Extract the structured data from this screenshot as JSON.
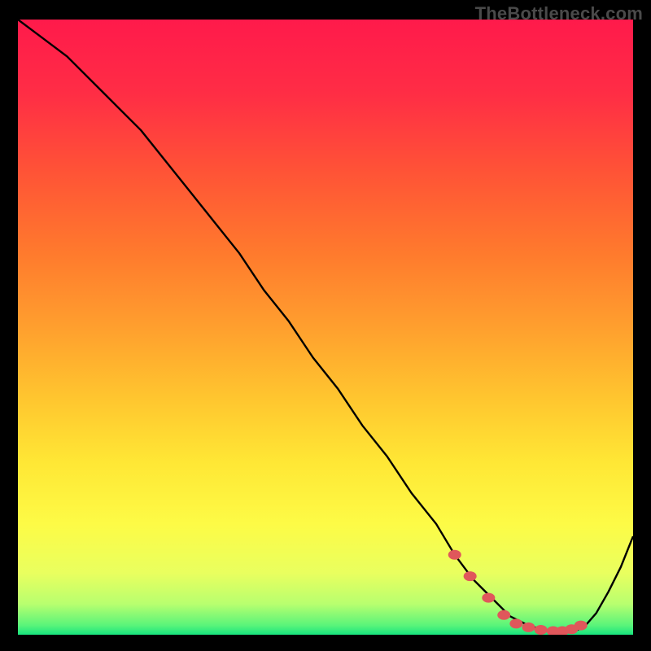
{
  "watermark": "TheBottleneck.com",
  "chart_data": {
    "type": "line",
    "title": "",
    "xlabel": "",
    "ylabel": "",
    "xlim": [
      0,
      100
    ],
    "ylim": [
      0,
      100
    ],
    "grid": false,
    "legend": false,
    "series": [
      {
        "name": "bottleneck-curve",
        "x": [
          0,
          4,
          8,
          12,
          16,
          20,
          24,
          28,
          32,
          36,
          40,
          44,
          48,
          52,
          56,
          60,
          64,
          68,
          71,
          74,
          77,
          80,
          83,
          86,
          88,
          90,
          92,
          94,
          96,
          98,
          100
        ],
        "y": [
          100,
          97,
          94,
          90,
          86,
          82,
          77,
          72,
          67,
          62,
          56,
          51,
          45,
          40,
          34,
          29,
          23,
          18,
          13,
          9,
          6,
          3,
          1.5,
          0.6,
          0.3,
          0.4,
          1.2,
          3.5,
          7,
          11,
          16
        ]
      }
    ],
    "markers": {
      "name": "highlight-dots",
      "color": "#e0575b",
      "x": [
        71,
        73.5,
        76.5,
        79,
        81,
        83,
        85,
        87,
        88.5,
        90,
        91.5
      ],
      "y": [
        13,
        9.5,
        6,
        3.2,
        1.8,
        1.2,
        0.8,
        0.6,
        0.6,
        0.9,
        1.5
      ]
    },
    "background_gradient_stops": [
      {
        "offset": 0.0,
        "color": "#ff1a4b"
      },
      {
        "offset": 0.12,
        "color": "#ff2d45"
      },
      {
        "offset": 0.25,
        "color": "#ff5436"
      },
      {
        "offset": 0.38,
        "color": "#ff7a2d"
      },
      {
        "offset": 0.5,
        "color": "#ff9f2e"
      },
      {
        "offset": 0.62,
        "color": "#ffc72f"
      },
      {
        "offset": 0.72,
        "color": "#ffe735"
      },
      {
        "offset": 0.82,
        "color": "#fdfb46"
      },
      {
        "offset": 0.9,
        "color": "#e9ff5f"
      },
      {
        "offset": 0.95,
        "color": "#b8ff6f"
      },
      {
        "offset": 0.985,
        "color": "#59f47a"
      },
      {
        "offset": 1.0,
        "color": "#17e47e"
      }
    ]
  }
}
